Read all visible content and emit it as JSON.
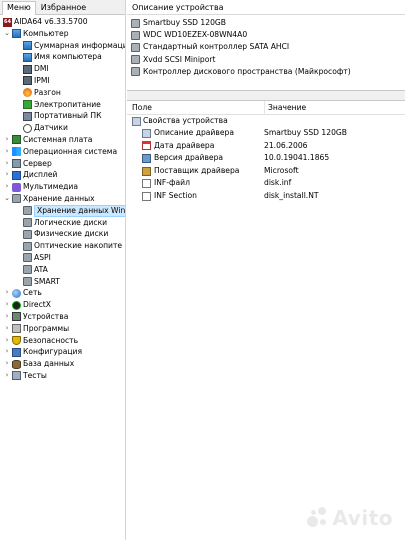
{
  "tabs": [
    "Меню",
    "Избранное"
  ],
  "tree": [
    {
      "label": "AIDA64 v6.33.5700",
      "icon": "aida-icon",
      "level": 0,
      "exp": ""
    },
    {
      "label": "Компьютер",
      "icon": "computer-icon",
      "level": 1,
      "exp": "v"
    },
    {
      "label": "Суммарная информация",
      "icon": "computer-icon",
      "level": 2,
      "exp": ""
    },
    {
      "label": "Имя компьютера",
      "icon": "computer-icon",
      "level": 2,
      "exp": ""
    },
    {
      "label": "DMI",
      "icon": "chip-icon",
      "level": 2,
      "exp": ""
    },
    {
      "label": "IPMI",
      "icon": "chip-icon",
      "level": 2,
      "exp": ""
    },
    {
      "label": "Разгон",
      "icon": "fire-icon",
      "level": 2,
      "exp": ""
    },
    {
      "label": "Электропитание",
      "icon": "power-icon",
      "level": 2,
      "exp": ""
    },
    {
      "label": "Портативный ПК",
      "icon": "laptop-icon",
      "level": 2,
      "exp": ""
    },
    {
      "label": "Датчики",
      "icon": "gauge-icon",
      "level": 2,
      "exp": ""
    },
    {
      "label": "Системная плата",
      "icon": "motherboard-icon",
      "level": 1,
      "exp": ">"
    },
    {
      "label": "Операционная система",
      "icon": "windows-icon",
      "level": 1,
      "exp": ">"
    },
    {
      "label": "Сервер",
      "icon": "server-icon",
      "level": 1,
      "exp": ">"
    },
    {
      "label": "Дисплей",
      "icon": "display-icon",
      "level": 1,
      "exp": ">"
    },
    {
      "label": "Мультимедиа",
      "icon": "multimedia-icon",
      "level": 1,
      "exp": ">"
    },
    {
      "label": "Хранение данных",
      "icon": "storage-icon",
      "level": 1,
      "exp": "v"
    },
    {
      "label": "Хранение данных Win",
      "icon": "storage-icon",
      "level": 2,
      "exp": "",
      "selected": true
    },
    {
      "label": "Логические диски",
      "icon": "storage-icon",
      "level": 2,
      "exp": ""
    },
    {
      "label": "Физические диски",
      "icon": "storage-icon",
      "level": 2,
      "exp": ""
    },
    {
      "label": "Оптические накопите",
      "icon": "storage-icon",
      "level": 2,
      "exp": ""
    },
    {
      "label": "ASPI",
      "icon": "storage-icon",
      "level": 2,
      "exp": ""
    },
    {
      "label": "ATA",
      "icon": "storage-icon",
      "level": 2,
      "exp": ""
    },
    {
      "label": "SMART",
      "icon": "storage-icon",
      "level": 2,
      "exp": ""
    },
    {
      "label": "Сеть",
      "icon": "network-icon",
      "level": 1,
      "exp": ">"
    },
    {
      "label": "DirectX",
      "icon": "directx-icon",
      "level": 1,
      "exp": ">"
    },
    {
      "label": "Устройства",
      "icon": "devices-icon",
      "level": 1,
      "exp": ">"
    },
    {
      "label": "Программы",
      "icon": "programs-icon",
      "level": 1,
      "exp": ">"
    },
    {
      "label": "Безопасность",
      "icon": "security-icon",
      "level": 1,
      "exp": ">"
    },
    {
      "label": "Конфигурация",
      "icon": "config-icon",
      "level": 1,
      "exp": ">"
    },
    {
      "label": "База данных",
      "icon": "database-icon",
      "level": 1,
      "exp": ">"
    },
    {
      "label": "Тесты",
      "icon": "tests-icon",
      "level": 1,
      "exp": ">"
    }
  ],
  "device_panel": {
    "header": "Описание устройства",
    "devices": [
      "Smartbuy SSD 120GB",
      "WDC WD10EZEX-08WN4A0",
      "Стандартный контроллер SATA AHCI",
      "Xvdd SCSI Miniport",
      "Контроллер дискового пространства (Майкрософт)"
    ]
  },
  "props": {
    "col_field": "Поле",
    "col_value": "Значение",
    "group_label": "Свойства устройства",
    "rows": [
      {
        "name": "Описание драйвера",
        "value": "Smartbuy SSD 120GB",
        "icon": "description-icon"
      },
      {
        "name": "Дата драйвера",
        "value": "21.06.2006",
        "icon": "calendar-icon"
      },
      {
        "name": "Версия драйвера",
        "value": "10.0.19041.1865",
        "icon": "version-icon"
      },
      {
        "name": "Поставщик драйвера",
        "value": "Microsoft",
        "icon": "vendor-icon"
      },
      {
        "name": "INF-файл",
        "value": "disk.inf",
        "icon": "file-icon"
      },
      {
        "name": "INF Section",
        "value": "disk_install.NT",
        "icon": "file-icon"
      }
    ]
  },
  "watermark": "Avito"
}
